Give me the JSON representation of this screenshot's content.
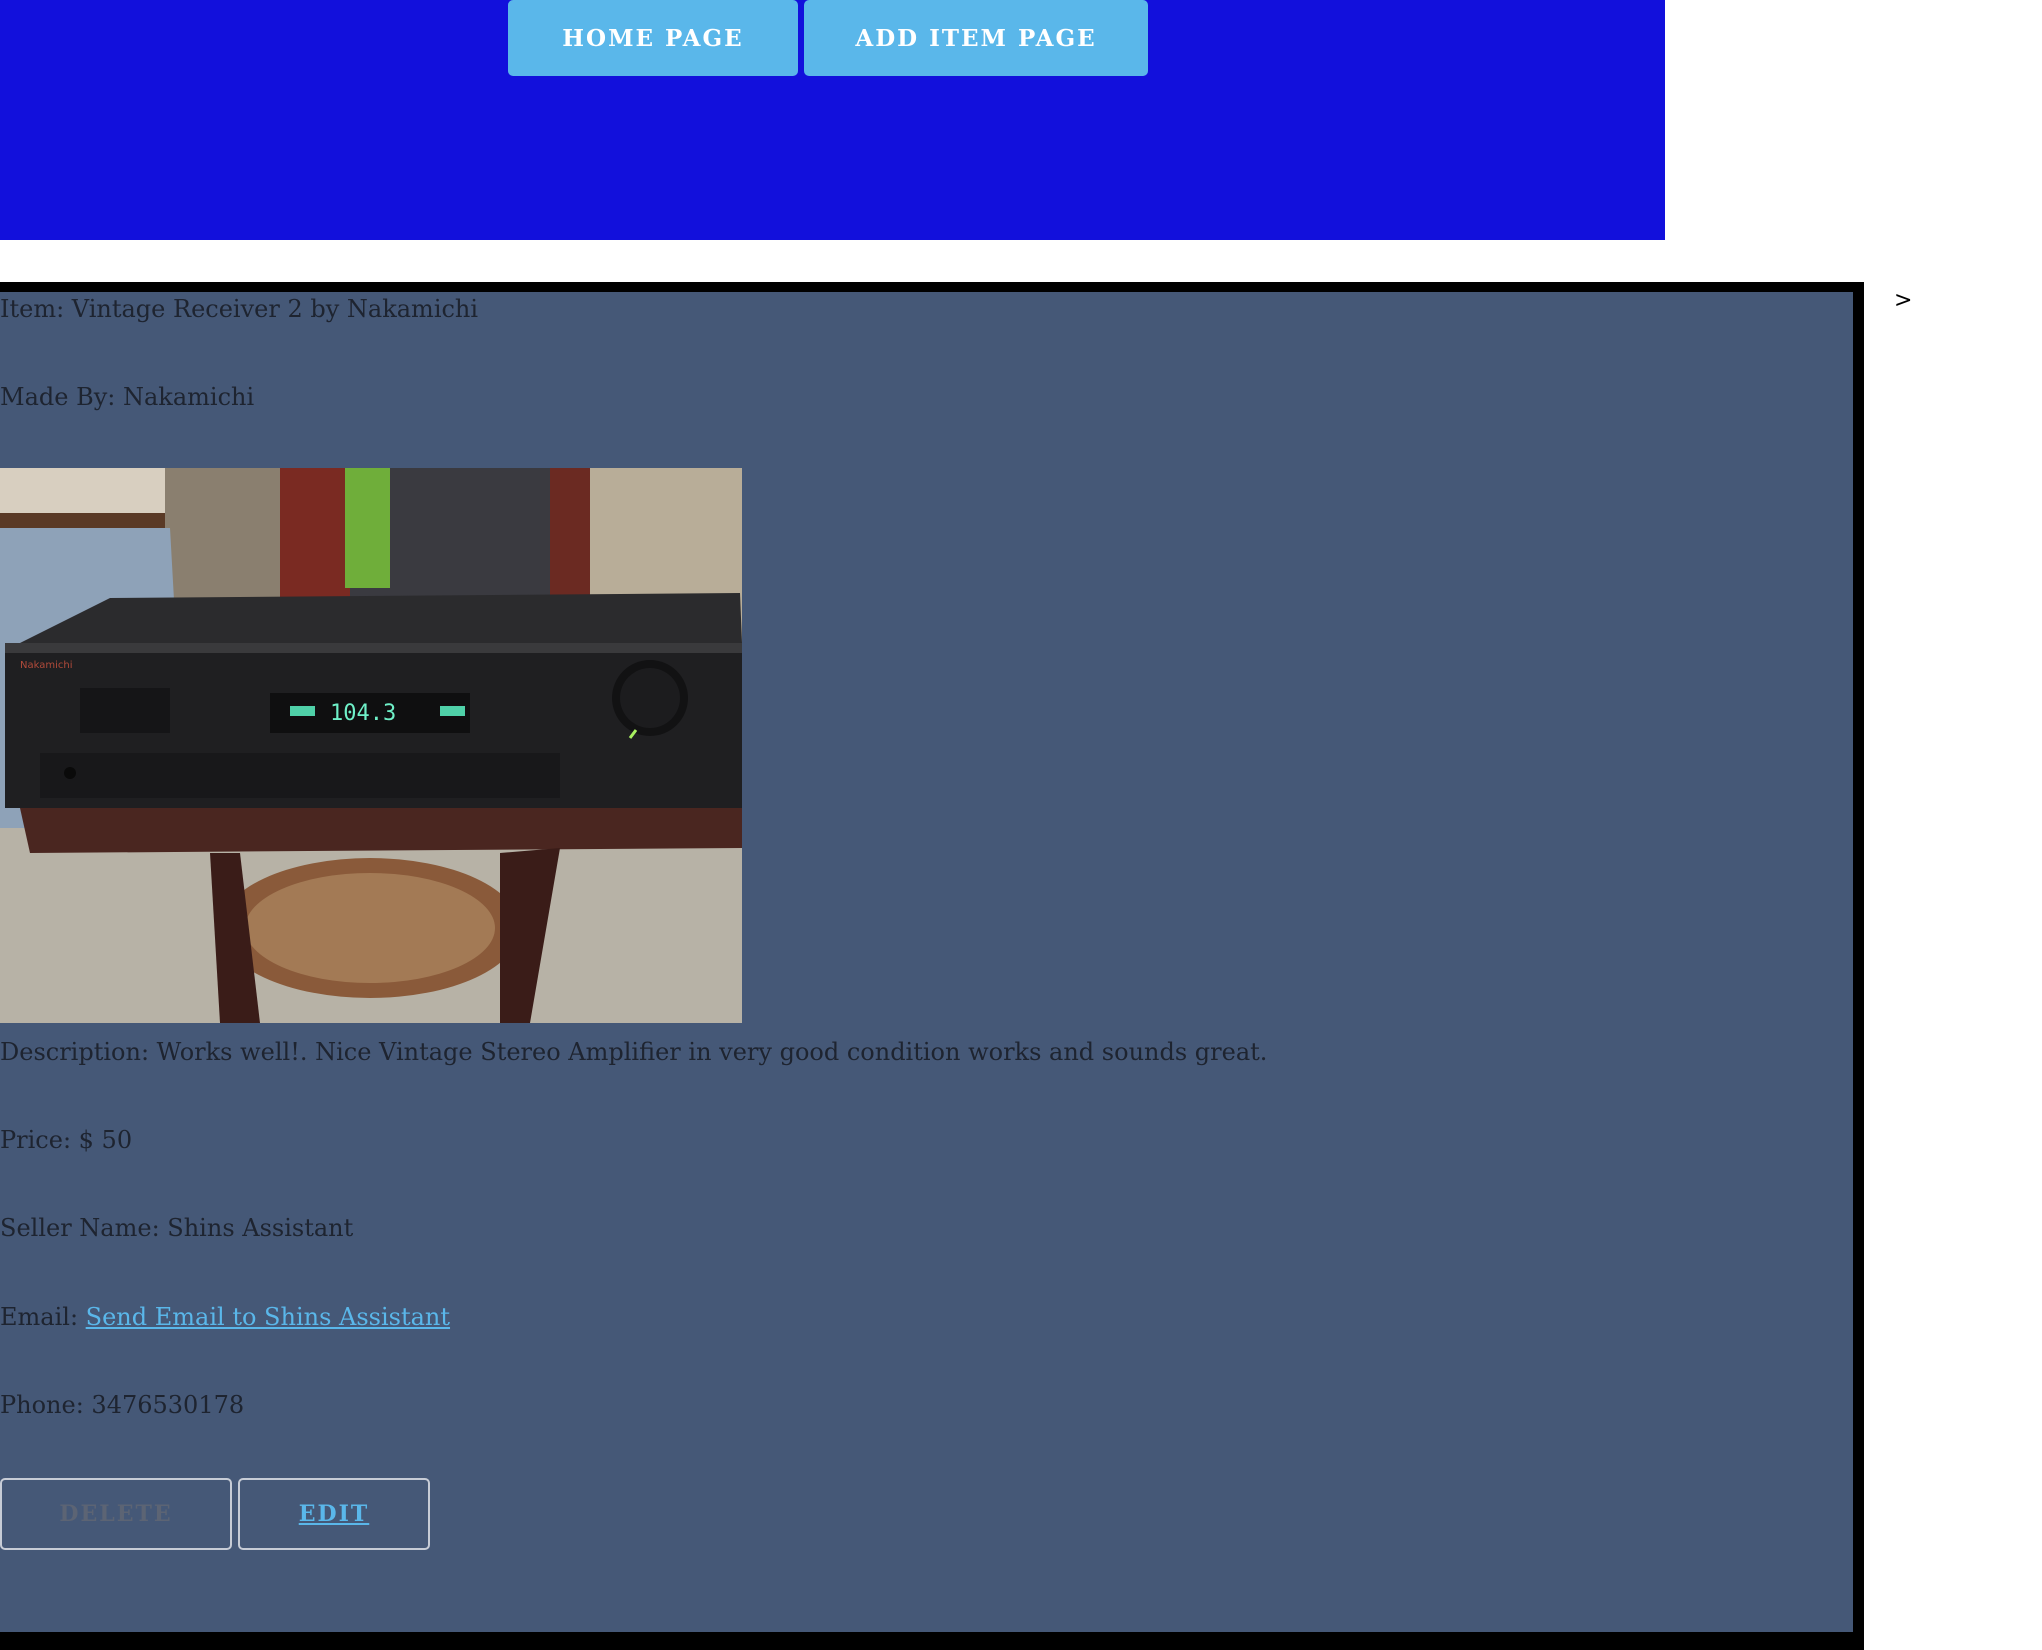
{
  "nav": {
    "home_label": "HOME PAGE",
    "add_item_label": "ADD ITEM PAGE"
  },
  "item": {
    "title": "Item: Vintage Receiver 2 by Nakamichi",
    "made_by": "Made By: Nakamichi",
    "photo_icon": "receiver-photo",
    "description": "Description: Works well!. Nice Vintage Stereo Amplifier in very good condition works and sounds great.",
    "price": "Price: $ 50",
    "seller": "Seller Name: Shins Assistant",
    "email_prefix": "Email: ",
    "email_link": "Send Email to Shins Assistant",
    "phone": "Phone: 3476530178"
  },
  "actions": {
    "delete_label": "DELETE",
    "edit_label": "EDIT"
  },
  "stray_char": ">",
  "colors": {
    "header_bg": "#1210dc",
    "nav_button_bg": "#5ab7ea",
    "card_bg": "#455877",
    "link": "#5ab7ea"
  }
}
